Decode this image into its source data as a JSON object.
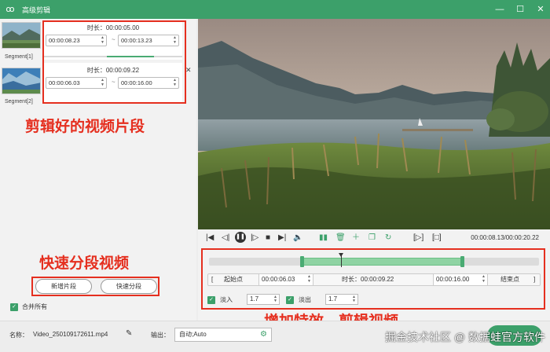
{
  "window": {
    "title": "高级剪辑",
    "controls": [
      "—",
      "☐",
      "✕"
    ]
  },
  "segments": [
    {
      "label": "Segment[1]",
      "duration": "时长：00:00:05.00",
      "start": "00:00:08.23",
      "end": "00:00:13.23"
    },
    {
      "label": "Segment[2]",
      "duration": "时长：00:00:09.22",
      "start": "00:00:06.03",
      "end": "00:00:16.00"
    }
  ],
  "left_actions": {
    "add_segment": "新增片段",
    "quick_split": "快速分段",
    "merge_all": "合并所有"
  },
  "annotations": {
    "clips": "剪辑好的视频片段",
    "quick": "快速分段视频",
    "effects": "增加特效，剪辑视频"
  },
  "player": {
    "time_readout": "00:00:08.13/00:00:20.22"
  },
  "timeline": {
    "selection": {
      "start": 0.28,
      "end": 0.77
    },
    "playhead": 0.4,
    "start_point_label": "起始点",
    "start_time": "00:00:06.03",
    "duration": "时长：00:00:09.22",
    "end_time": "00:00:16.00",
    "end_point_label": "结束点",
    "fade_in_label": "淡入",
    "fade_in_value": "1.7",
    "fade_out_label": "淡出",
    "fade_out_value": "1.7"
  },
  "bottom": {
    "name_label": "名称：",
    "name_value": "Video_250109172611.mp4",
    "output_label": "输出：",
    "output_value": "自动;Auto",
    "watermark": "掘金技术社区 @ 数据蛙官方软件"
  },
  "colors": {
    "brand": "#3ca06a",
    "annotation": "#e52f1f",
    "selection": "#8fd3a3"
  }
}
